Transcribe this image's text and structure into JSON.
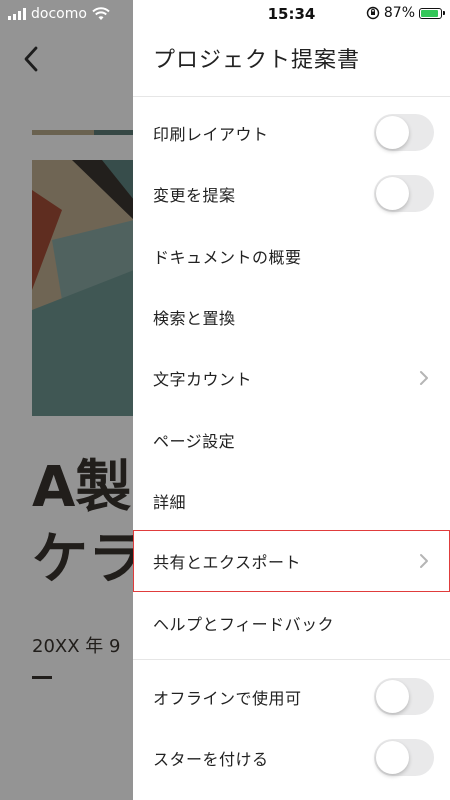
{
  "status": {
    "carrier": "docomo",
    "time": "15:34",
    "battery": "87%",
    "battery_level": 0.87
  },
  "document": {
    "title_line1": "A製",
    "title_line2": "ケラ",
    "date": "20XX 年 9"
  },
  "menu": {
    "title": "プロジェクト提案書",
    "items": [
      {
        "label": "印刷レイアウト",
        "control": "toggle"
      },
      {
        "label": "変更を提案",
        "control": "toggle"
      },
      {
        "label": "ドキュメントの概要",
        "control": "none"
      },
      {
        "label": "検索と置換",
        "control": "none"
      },
      {
        "label": "文字カウント",
        "control": "chevron"
      },
      {
        "label": "ページ設定",
        "control": "none"
      },
      {
        "label": "詳細",
        "control": "none"
      },
      {
        "label": "共有とエクスポート",
        "control": "chevron",
        "highlighted": true
      },
      {
        "label": "ヘルプとフィードバック",
        "control": "none"
      },
      {
        "label": "オフラインで使用可",
        "control": "toggle"
      },
      {
        "label": "スターを付ける",
        "control": "toggle"
      }
    ]
  },
  "colors": {
    "highlight": "#e03c3c",
    "toggle_off": "#e9e9ea",
    "overlay": "#000000"
  }
}
